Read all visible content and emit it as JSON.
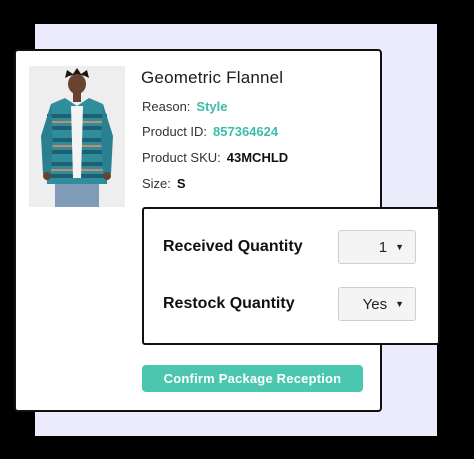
{
  "product": {
    "title": "Geometric Flannel",
    "reason_label": "Reason:",
    "reason_value": "Style",
    "id_label": "Product ID:",
    "id_value": "857364624",
    "sku_label": "Product SKU:",
    "sku_value": "43MCHLD",
    "size_label": "Size:",
    "size_value": "S"
  },
  "quantities": {
    "received_label": "Received Quantity",
    "received_value": "1",
    "restock_label": "Restock Quantity",
    "restock_value": "Yes"
  },
  "actions": {
    "confirm_label": "Confirm Package Reception"
  },
  "colors": {
    "accent": "#3bbcaa",
    "button": "#4bc7b0",
    "backdrop": "#ecebfc"
  }
}
